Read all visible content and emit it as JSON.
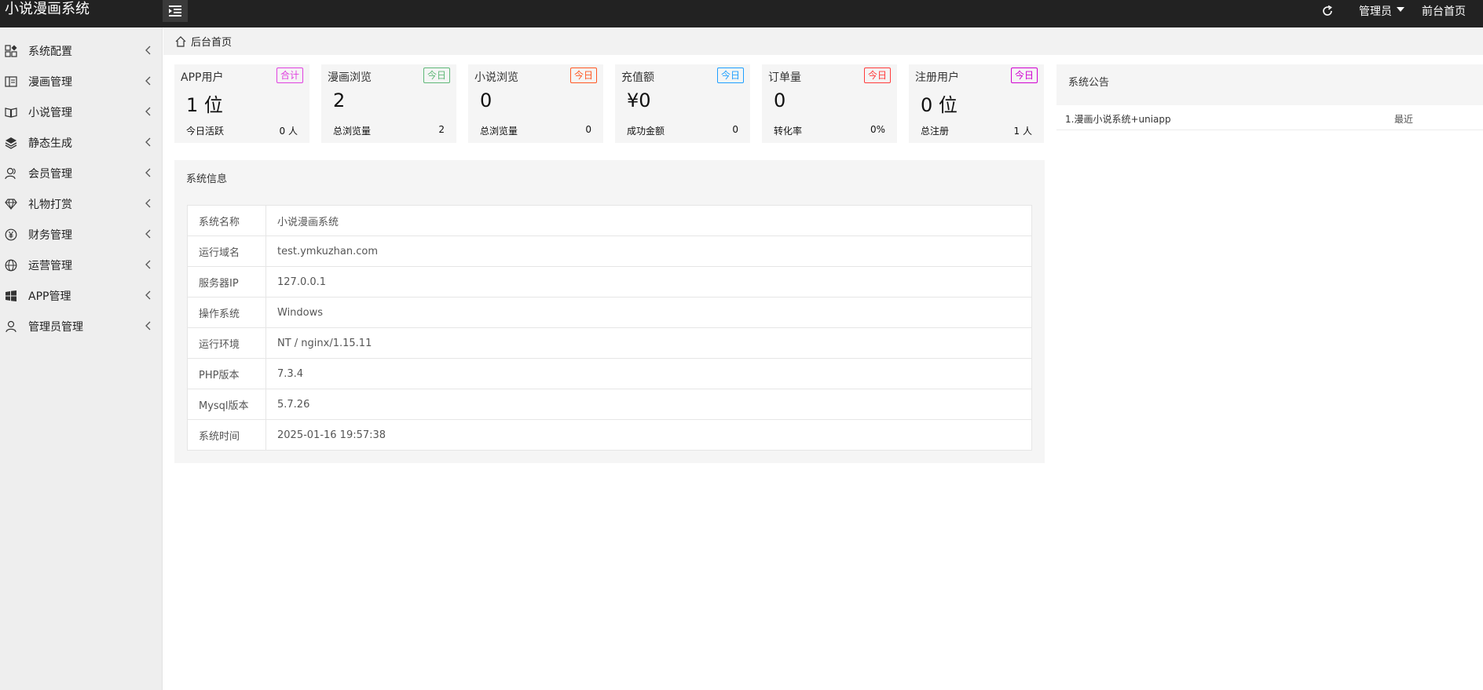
{
  "header": {
    "app_title": "小说漫画系统",
    "admin_label": "管理员",
    "front_link": "前台首页"
  },
  "sidebar": {
    "items": [
      {
        "label": "系统配置",
        "icon": "dashboard-icon"
      },
      {
        "label": "漫画管理",
        "icon": "book-columns-icon"
      },
      {
        "label": "小说管理",
        "icon": "open-book-icon"
      },
      {
        "label": "静态生成",
        "icon": "layers-icon"
      },
      {
        "label": "会员管理",
        "icon": "users-icon"
      },
      {
        "label": "礼物打赏",
        "icon": "diamond-icon"
      },
      {
        "label": "财务管理",
        "icon": "yen-circle-icon"
      },
      {
        "label": "运营管理",
        "icon": "globe-icon"
      },
      {
        "label": "APP管理",
        "icon": "windows-icon"
      },
      {
        "label": "管理员管理",
        "icon": "user-icon"
      }
    ]
  },
  "breadcrumb": {
    "label": "后台首页"
  },
  "stats": [
    {
      "title": "APP用户",
      "badge": "合计",
      "badge_color": "#e040e0",
      "value": "1 位",
      "sub_label": "今日活跃",
      "sub_value": "0 人"
    },
    {
      "title": "漫画浏览",
      "badge": "今日",
      "badge_color": "#5fb878",
      "value": "2",
      "sub_label": "总浏览量",
      "sub_value": "2"
    },
    {
      "title": "小说浏览",
      "badge": "今日",
      "badge_color": "#ff5722",
      "value": "0",
      "sub_label": "总浏览量",
      "sub_value": "0"
    },
    {
      "title": "充值额",
      "badge": "今日",
      "badge_color": "#1e9fff",
      "value": "¥0",
      "sub_label": "成功金额",
      "sub_value": "0"
    },
    {
      "title": "订单量",
      "badge": "今日",
      "badge_color": "#ff3b3b",
      "value": "0",
      "sub_label": "转化率",
      "sub_value": "0%"
    },
    {
      "title": "注册用户",
      "badge": "今日",
      "badge_color": "#d100d1",
      "value": "0 位",
      "sub_label": "总注册",
      "sub_value": "1 人"
    }
  ],
  "system_info": {
    "title": "系统信息",
    "rows": [
      {
        "key": "系统名称",
        "value": "小说漫画系统"
      },
      {
        "key": "运行域名",
        "value": "test.ymkuzhan.com"
      },
      {
        "key": "服务器IP",
        "value": "127.0.0.1"
      },
      {
        "key": "操作系统",
        "value": "Windows"
      },
      {
        "key": "运行环境",
        "value": "NT / nginx/1.15.11"
      },
      {
        "key": "PHP版本",
        "value": "7.3.4"
      },
      {
        "key": "Mysql版本",
        "value": "5.7.26"
      },
      {
        "key": "系统时间",
        "value": "2025-01-16 19:57:38"
      }
    ]
  },
  "notice": {
    "title": "系统公告",
    "items": [
      {
        "text": "1.漫画小说系统+uniapp",
        "date": "最近"
      }
    ]
  }
}
